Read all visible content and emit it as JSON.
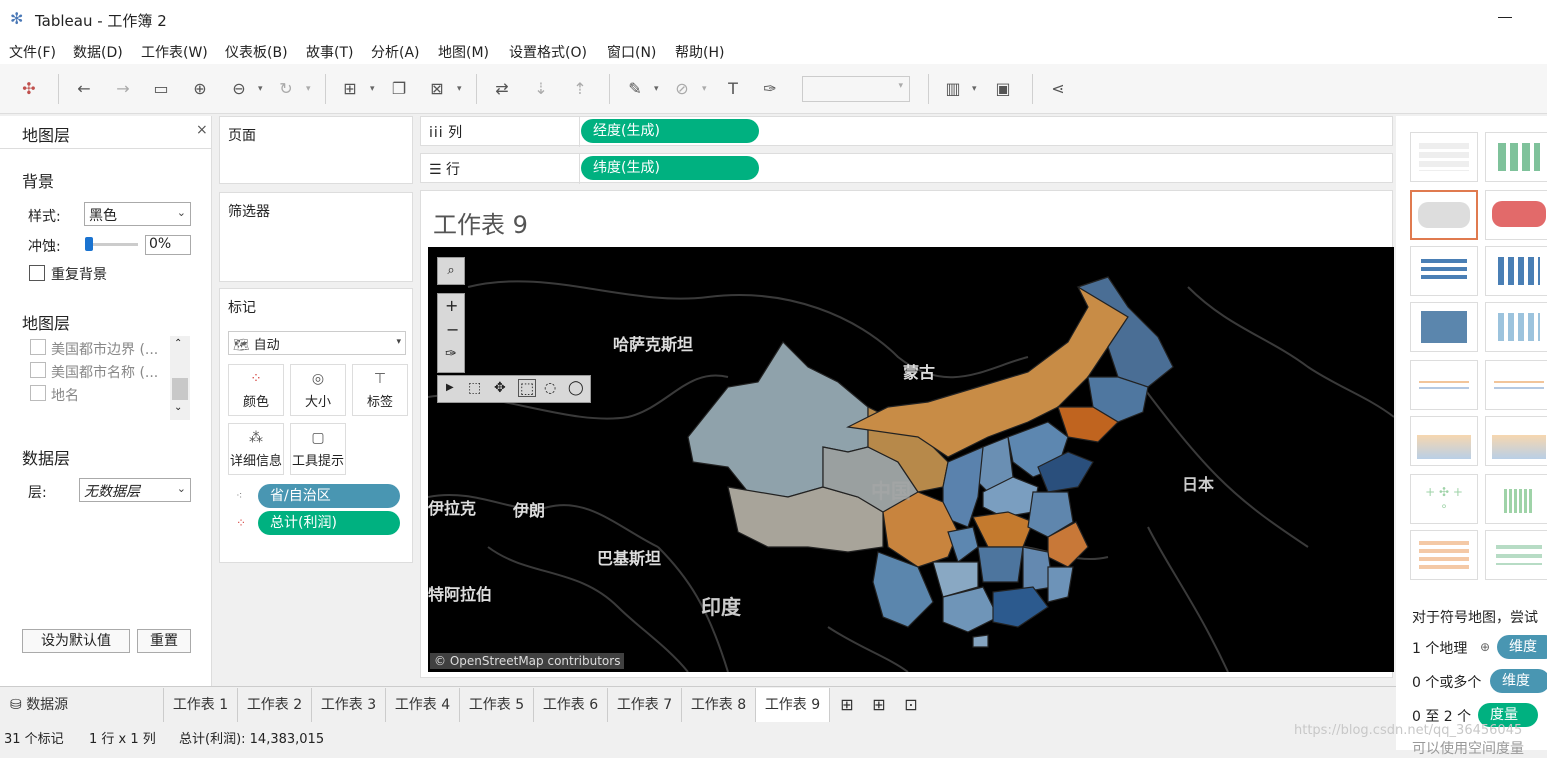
{
  "window": {
    "title": "Tableau - 工作簿 2"
  },
  "menu": [
    "文件(F)",
    "数据(D)",
    "工作表(W)",
    "仪表板(B)",
    "故事(T)",
    "分析(A)",
    "地图(M)",
    "设置格式(O)",
    "窗口(N)",
    "帮助(H)"
  ],
  "left": {
    "title": "地图层",
    "background_h": "背景",
    "style_label": "样式:",
    "style_value": "黑色",
    "washout_label": "冲蚀:",
    "washout_value": "0%",
    "repeat_label": "重复背景",
    "layers_h": "地图层",
    "layers": [
      "美国都市边界 (...",
      "美国都市名称 (...",
      "地名"
    ],
    "data_h": "数据层",
    "layer_label": "层:",
    "layer_value": "无数据层",
    "default_btn": "设为默认值",
    "reset_btn": "重置"
  },
  "mid": {
    "pages": "页面",
    "filters": "筛选器",
    "marks": "标记",
    "mark_type": "自动",
    "mark_buttons": [
      "颜色",
      "大小",
      "标签",
      "详细信息",
      "工具提示"
    ],
    "pill1": "省/自治区",
    "pill2": "总计(利润)"
  },
  "shelves": {
    "col_label": "列",
    "col_pill": "经度(生成)",
    "row_label": "行",
    "row_pill": "纬度(生成)"
  },
  "viz": {
    "title": "工作表 9",
    "labels": [
      "哈萨克斯坦",
      "蒙古",
      "中国",
      "伊朗",
      "巴基斯坦",
      "印度",
      "日本",
      "伊拉克",
      "特阿拉伯"
    ],
    "attribution": "© OpenStreetMap contributors"
  },
  "right": {
    "hint": "对于符号地图，尝试",
    "req1": "1 个地理",
    "req1_pill": "维度",
    "req2": "0 个或多个",
    "req2_pill": "维度",
    "req3": "0 至 2 个",
    "req3_pill": "度量",
    "cut": "可以使用空间度量"
  },
  "tabs": {
    "datasource": "数据源",
    "sheets": [
      "工作表 1",
      "工作表 2",
      "工作表 3",
      "工作表 4",
      "工作表 5",
      "工作表 6",
      "工作表 7",
      "工作表 8",
      "工作表 9"
    ],
    "active": "工作表 9"
  },
  "status": {
    "marks": "31 个标记",
    "grid": "1 行 x 1 列",
    "sum": "总计(利润): 14,383,015",
    "watermark": "https://blog.csdn.net/qq_36456045"
  },
  "colors": {
    "accent": "#00b180",
    "dim_pill": "#4996b2",
    "selected_thumb": "#e07a4f"
  }
}
